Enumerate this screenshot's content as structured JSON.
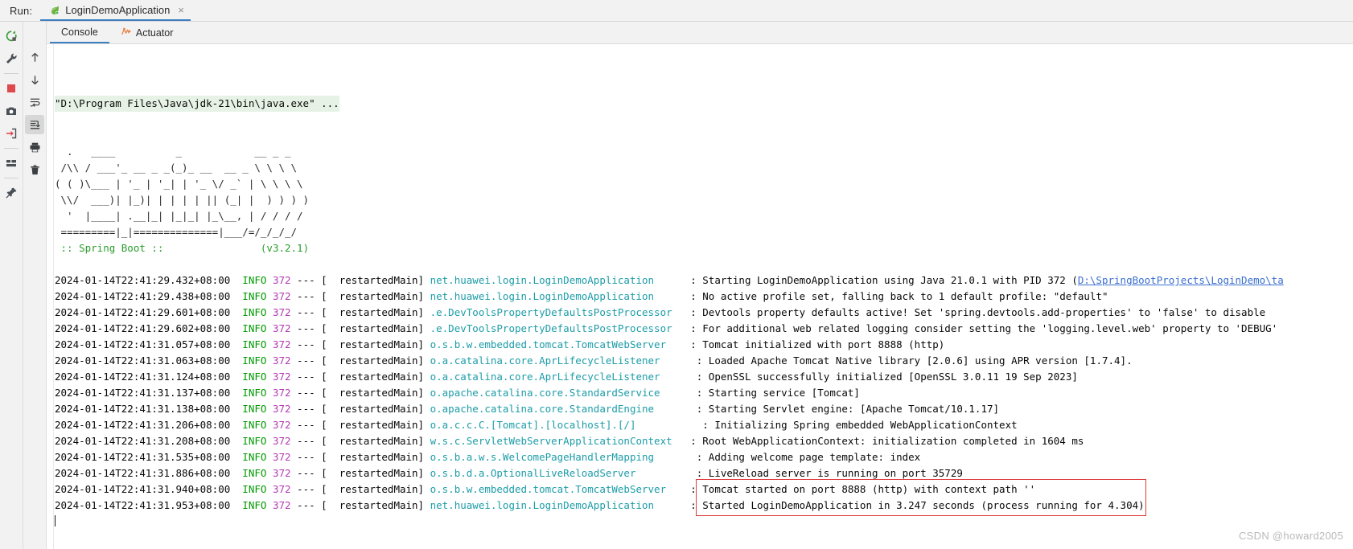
{
  "window": {
    "run_label": "Run:",
    "run_tab_title": "LoginDemoApplication",
    "run_tab_close": "×",
    "run_tab_icon": "spring-leaf-icon"
  },
  "left_toolbar": {
    "items": [
      {
        "name": "rerun-icon",
        "title": "Rerun"
      },
      {
        "name": "wrench-settings-icon",
        "title": "Settings"
      },
      {
        "name": "stop-icon",
        "title": "Stop"
      },
      {
        "name": "camera-snapshot-icon",
        "title": "Snapshot"
      },
      {
        "name": "import-arrow-icon",
        "title": "Open"
      },
      {
        "name": "layout-icon",
        "title": "Layout"
      },
      {
        "name": "pin-icon",
        "title": "Pin Tab"
      }
    ]
  },
  "console_toolbar": {
    "items": [
      {
        "name": "scroll-up-icon",
        "title": "Up"
      },
      {
        "name": "scroll-down-icon",
        "title": "Down"
      },
      {
        "name": "soft-wrap-icon",
        "title": "Soft-Wrap"
      },
      {
        "name": "scroll-to-end-icon",
        "title": "Scroll to End",
        "selected": true
      },
      {
        "name": "print-icon",
        "title": "Print"
      },
      {
        "name": "trash-icon",
        "title": "Clear All"
      }
    ]
  },
  "tabs": [
    {
      "label": "Console",
      "active": true,
      "icon": null
    },
    {
      "label": "Actuator",
      "active": false,
      "icon": "actuator-icon"
    }
  ],
  "console": {
    "command_line": "\"D:\\Program Files\\Java\\jdk-21\\bin\\java.exe\" ...",
    "banner": [
      "  .   ____          _            __ _ _",
      " /\\\\ / ___'_ __ _ _(_)_ __  __ _ \\ \\ \\ \\",
      "( ( )\\___ | '_ | '_| | '_ \\/ _` | \\ \\ \\ \\",
      " \\\\/  ___)| |_)| | | | | || (_| |  ) ) ) )",
      "  '  |____| .__|_| |_|_| |_\\__, | / / / /",
      " =========|_|==============|___/=/_/_/_/"
    ],
    "banner_title": " :: Spring Boot :: ",
    "banner_version": "(v3.2.1)",
    "banner_version_pad": "               ",
    "log_lines": [
      {
        "timestamp": "2024-01-14T22:41:29.432+08:00",
        "level": "INFO",
        "pid": "372",
        "sep": "--- [",
        "thread": "  restartedMain]",
        "logger": "net.huawei.login.LoginDemoApplication",
        "logger_pad": "      ",
        "message": ": Starting LoginDemoApplication using Java 21.0.1 with PID 372 (",
        "link": "D:\\SpringBootProjects\\LoginDemo\\ta",
        "highlight": false
      },
      {
        "timestamp": "2024-01-14T22:41:29.438+08:00",
        "level": "INFO",
        "pid": "372",
        "sep": "--- [",
        "thread": "  restartedMain]",
        "logger": "net.huawei.login.LoginDemoApplication",
        "logger_pad": "      ",
        "message": ": No active profile set, falling back to 1 default profile: \"default\"",
        "link": "",
        "highlight": false
      },
      {
        "timestamp": "2024-01-14T22:41:29.601+08:00",
        "level": "INFO",
        "pid": "372",
        "sep": "--- [",
        "thread": "  restartedMain]",
        "logger": ".e.DevToolsPropertyDefaultsPostProcessor",
        "logger_pad": "   ",
        "message": ": Devtools property defaults active! Set 'spring.devtools.add-properties' to 'false' to disable",
        "link": "",
        "highlight": false
      },
      {
        "timestamp": "2024-01-14T22:41:29.602+08:00",
        "level": "INFO",
        "pid": "372",
        "sep": "--- [",
        "thread": "  restartedMain]",
        "logger": ".e.DevToolsPropertyDefaultsPostProcessor",
        "logger_pad": "   ",
        "message": ": For additional web related logging consider setting the 'logging.level.web' property to 'DEBUG'",
        "link": "",
        "highlight": false
      },
      {
        "timestamp": "2024-01-14T22:41:31.057+08:00",
        "level": "INFO",
        "pid": "372",
        "sep": "--- [",
        "thread": "  restartedMain]",
        "logger": "o.s.b.w.embedded.tomcat.TomcatWebServer",
        "logger_pad": "    ",
        "message": ": Tomcat initialized with port 8888 (http)",
        "link": "",
        "highlight": false
      },
      {
        "timestamp": "2024-01-14T22:41:31.063+08:00",
        "level": "INFO",
        "pid": "372",
        "sep": "--- [",
        "thread": "  restartedMain]",
        "logger": "o.a.catalina.core.AprLifecycleListener",
        "logger_pad": "      ",
        "message": ": Loaded Apache Tomcat Native library [2.0.6] using APR version [1.7.4].",
        "link": "",
        "highlight": false
      },
      {
        "timestamp": "2024-01-14T22:41:31.124+08:00",
        "level": "INFO",
        "pid": "372",
        "sep": "--- [",
        "thread": "  restartedMain]",
        "logger": "o.a.catalina.core.AprLifecycleListener",
        "logger_pad": "      ",
        "message": ": OpenSSL successfully initialized [OpenSSL 3.0.11 19 Sep 2023]",
        "link": "",
        "highlight": false
      },
      {
        "timestamp": "2024-01-14T22:41:31.137+08:00",
        "level": "INFO",
        "pid": "372",
        "sep": "--- [",
        "thread": "  restartedMain]",
        "logger": "o.apache.catalina.core.StandardService",
        "logger_pad": "      ",
        "message": ": Starting service [Tomcat]",
        "link": "",
        "highlight": false
      },
      {
        "timestamp": "2024-01-14T22:41:31.138+08:00",
        "level": "INFO",
        "pid": "372",
        "sep": "--- [",
        "thread": "  restartedMain]",
        "logger": "o.apache.catalina.core.StandardEngine",
        "logger_pad": "       ",
        "message": ": Starting Servlet engine: [Apache Tomcat/10.1.17]",
        "link": "",
        "highlight": false
      },
      {
        "timestamp": "2024-01-14T22:41:31.206+08:00",
        "level": "INFO",
        "pid": "372",
        "sep": "--- [",
        "thread": "  restartedMain]",
        "logger": "o.a.c.c.C.[Tomcat].[localhost].[/]",
        "logger_pad": "           ",
        "message": ": Initializing Spring embedded WebApplicationContext",
        "link": "",
        "highlight": false
      },
      {
        "timestamp": "2024-01-14T22:41:31.208+08:00",
        "level": "INFO",
        "pid": "372",
        "sep": "--- [",
        "thread": "  restartedMain]",
        "logger": "w.s.c.ServletWebServerApplicationContext",
        "logger_pad": "   ",
        "message": ": Root WebApplicationContext: initialization completed in 1604 ms",
        "link": "",
        "highlight": false
      },
      {
        "timestamp": "2024-01-14T22:41:31.535+08:00",
        "level": "INFO",
        "pid": "372",
        "sep": "--- [",
        "thread": "  restartedMain]",
        "logger": "o.s.b.a.w.s.WelcomePageHandlerMapping",
        "logger_pad": "       ",
        "message": ": Adding welcome page template: index",
        "link": "",
        "highlight": false
      },
      {
        "timestamp": "2024-01-14T22:41:31.886+08:00",
        "level": "INFO",
        "pid": "372",
        "sep": "--- [",
        "thread": "  restartedMain]",
        "logger": "o.s.b.d.a.OptionalLiveReloadServer",
        "logger_pad": "          ",
        "message": ": LiveReload server is running on port 35729",
        "link": "",
        "highlight": false
      },
      {
        "timestamp": "2024-01-14T22:41:31.940+08:00",
        "level": "INFO",
        "pid": "372",
        "sep": "--- [",
        "thread": "  restartedMain]",
        "logger": "o.s.b.w.embedded.tomcat.TomcatWebServer",
        "logger_pad": "    ",
        "message": ": Tomcat started on port 8888 (http) with context path ''",
        "link": "",
        "highlight": true
      },
      {
        "timestamp": "2024-01-14T22:41:31.953+08:00",
        "level": "INFO",
        "pid": "372",
        "sep": "--- [",
        "thread": "  restartedMain]",
        "logger": "net.huawei.login.LoginDemoApplication",
        "logger_pad": "      ",
        "message": ": Started LoginDemoApplication in 3.247 seconds (process running for 4.304)",
        "link": "",
        "highlight": true
      }
    ]
  },
  "watermark": "CSDN @howard2005",
  "colors": {
    "accent_blue": "#3e7fc1",
    "level_green": "#009900",
    "pid_magenta": "#b33ab3",
    "logger_teal": "#1c9ca8",
    "link_blue": "#3a6ed0",
    "highlight_red": "#e03c3c",
    "cmd_bg_green": "#e5f2e5",
    "banner_green": "#2a9d2a"
  }
}
